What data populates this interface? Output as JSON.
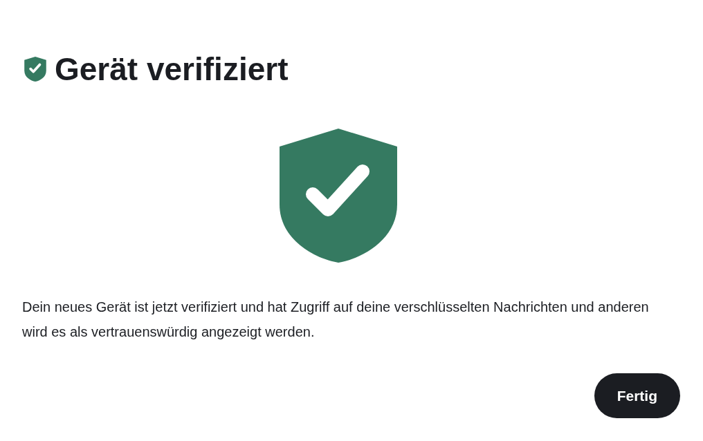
{
  "dialog": {
    "title": "Gerät verifiziert",
    "message": "Dein neues Gerät ist jetzt verifiziert und hat Zugriff auf deine verschlüsselten Nachrichten und anderen wird es als vertrauenswürdig angezeigt werden.",
    "buttons": [
      "Fertig"
    ]
  }
}
